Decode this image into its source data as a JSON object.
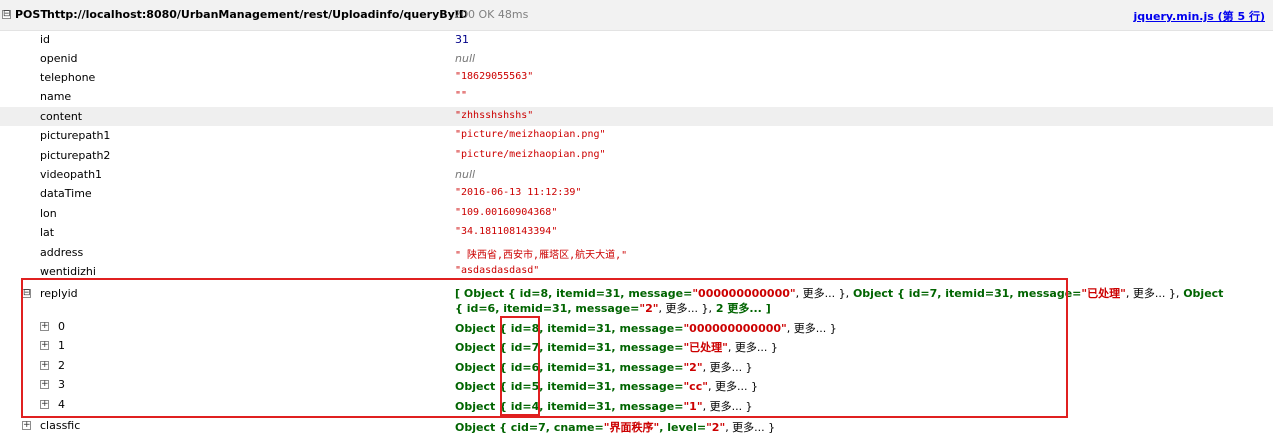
{
  "request": {
    "toggle": "⊟",
    "method": "POST",
    "url": "http://localhost:8080/UrbanManagement/rest/Uploadinfo/queryByID",
    "status": "200 OK 48ms",
    "source": "jquery.min.js (第 5 行)"
  },
  "fields": [
    {
      "key": "id",
      "value": "31",
      "type": "num"
    },
    {
      "key": "openid",
      "value": "null",
      "type": "nul"
    },
    {
      "key": "telephone",
      "value": "\"18629055563\"",
      "type": "str"
    },
    {
      "key": "name",
      "value": "\"\"",
      "type": "str"
    },
    {
      "key": "content",
      "value": "\"zhhsshshshs\"",
      "type": "str"
    },
    {
      "key": "picturepath1",
      "value": "\"picture/meizhaopian.png\"",
      "type": "str"
    },
    {
      "key": "picturepath2",
      "value": "\"picture/meizhaopian.png\"",
      "type": "str"
    },
    {
      "key": "videopath1",
      "value": "null",
      "type": "nul"
    },
    {
      "key": "dataTime",
      "value": "\"2016-06-13 11:12:39\"",
      "type": "str"
    },
    {
      "key": "lon",
      "value": "\"109.00160904368\"",
      "type": "str"
    },
    {
      "key": "lat",
      "value": "\"34.181108143394\"",
      "type": "str"
    },
    {
      "key": "address",
      "value": "\" 陕西省,西安市,雁塔区,航天大道,\"",
      "type": "str"
    },
    {
      "key": "wentidizhi",
      "value": "\"asdasdasdasd\"",
      "type": "str"
    }
  ],
  "replyid": {
    "key": "replyid",
    "toggle": "⊟",
    "summary": {
      "open": "[ Object {",
      "p1": "id=8,",
      "p2": "itemid=31,",
      "p3": "message=",
      "s1": "\"000000000000\"",
      "more1": ", 更多... },",
      "o2": "Object {",
      "q1": "id=7,",
      "q2": "itemid=31,",
      "q3": "message=",
      "s2": "\"已处理\"",
      "more2": ", 更多... },",
      "o3": "Object {",
      "r1": "id=6,",
      "r2": "itemid=31,",
      "r3": "message=",
      "s3": "\"2\"",
      "more3": ", 更多... },",
      "tail": "2 更多... ]"
    },
    "children": [
      {
        "idx": "0",
        "obj": "Object {",
        "id": "id=8,",
        "itemid": "itemid=31,",
        "msgk": "message=",
        "msg": "\"000000000000\"",
        "more": ", 更多... }"
      },
      {
        "idx": "1",
        "obj": "Object {",
        "id": "id=7,",
        "itemid": "itemid=31,",
        "msgk": "message=",
        "msg": "\"已处理\"",
        "more": ", 更多... }"
      },
      {
        "idx": "2",
        "obj": "Object {",
        "id": "id=6,",
        "itemid": "itemid=31,",
        "msgk": "message=",
        "msg": "\"2\"",
        "more": ", 更多... }"
      },
      {
        "idx": "3",
        "obj": "Object {",
        "id": "id=5,",
        "itemid": "itemid=31,",
        "msgk": "message=",
        "msg": "\"cc\"",
        "more": ", 更多... }"
      },
      {
        "idx": "4",
        "obj": "Object {",
        "id": "id=4,",
        "itemid": "itemid=31,",
        "msgk": "message=",
        "msg": "\"1\"",
        "more": ", 更多... }"
      }
    ]
  },
  "classfic": {
    "key": "classfic",
    "obj": "Object {",
    "cid": "cid=7,",
    "cnamek": "cname=",
    "cname": "\"界面秩序\"",
    "levelk": ", level=",
    "level": "\"2\"",
    "more": ", 更多... }"
  },
  "icons": {
    "expanded": "minus-box-icon",
    "collapsed": "plus-box-icon"
  },
  "colors": {
    "string": "#cc0000",
    "object": "#006400",
    "number": "#000088",
    "highlight_box": "#e02020"
  }
}
